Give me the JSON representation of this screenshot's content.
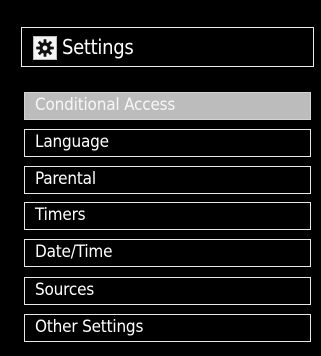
{
  "header": {
    "title": "Settings",
    "icon": "gear-icon"
  },
  "menu": {
    "items": [
      {
        "label": "Conditional Access",
        "selected": true
      },
      {
        "label": "Language",
        "selected": false
      },
      {
        "label": "Parental",
        "selected": false
      },
      {
        "label": "Timers",
        "selected": false
      },
      {
        "label": "Date/Time",
        "selected": false
      },
      {
        "label": "Sources",
        "selected": false
      },
      {
        "label": "Other Settings",
        "selected": false
      }
    ]
  },
  "colors": {
    "background": "#000000",
    "border": "#e8e8e8",
    "selected_background": "#bcbcbc",
    "text": "#ffffff"
  }
}
